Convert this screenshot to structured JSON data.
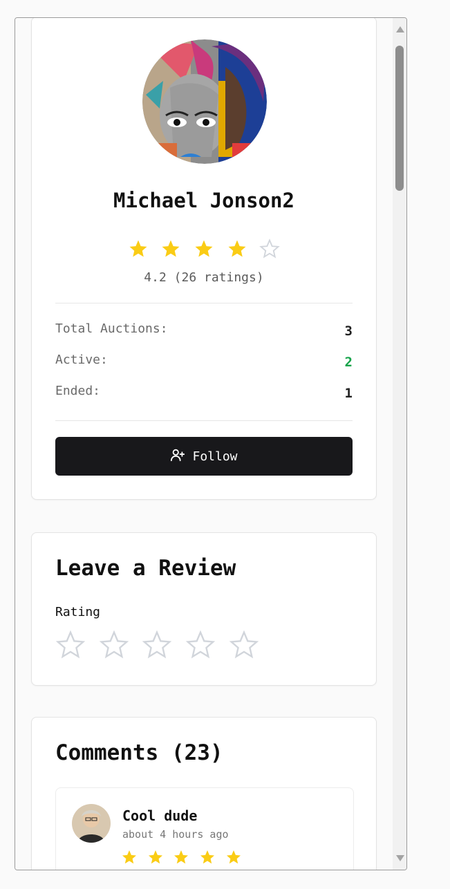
{
  "profile": {
    "name": "Michael Jonson2",
    "rating": 4.2,
    "rating_text": "4.2 (26 ratings)",
    "stars_filled": 4,
    "stars_total": 5,
    "stats": {
      "total_label": "Total Auctions:",
      "total_value": "3",
      "active_label": "Active:",
      "active_value": "2",
      "ended_label": "Ended:",
      "ended_value": "1"
    },
    "follow_label": "Follow"
  },
  "review": {
    "title": "Leave a Review",
    "rating_label": "Rating",
    "stars_total": 5
  },
  "comments": {
    "title": "Comments (23)",
    "items": [
      {
        "author": "Cool dude",
        "time": "about 4 hours ago",
        "stars": 5
      }
    ]
  },
  "colors": {
    "star_filled": "#facc15",
    "star_empty": "#d1d5db",
    "active_green": "#16a34a",
    "button_bg": "#18181b"
  },
  "icons": {
    "filled_star": "star-icon",
    "empty_star": "star-outline-icon",
    "follow": "user-plus-icon"
  }
}
